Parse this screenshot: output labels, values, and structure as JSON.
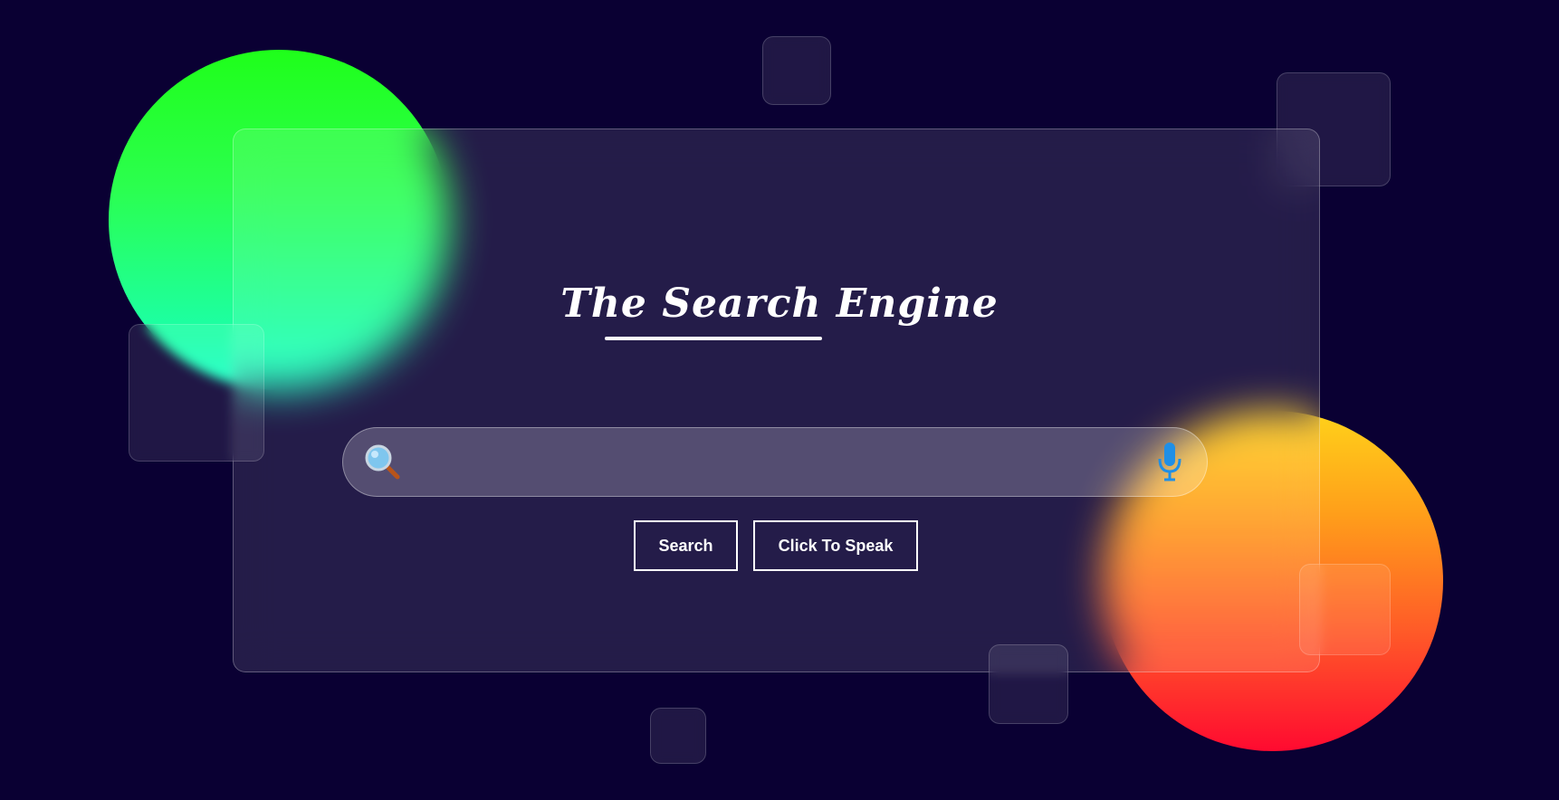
{
  "app": {
    "title": "The Search Engine"
  },
  "search": {
    "value": "",
    "placeholder": "",
    "search_icon": "magnifying-glass-icon",
    "mic_icon": "microphone-icon"
  },
  "buttons": {
    "search_label": "Search",
    "speak_label": "Click To Speak"
  },
  "theme": {
    "background": "#0a0033",
    "accent_green": "#1fff1a",
    "accent_teal": "#16ffc8",
    "accent_orange": "#ff9f1a",
    "accent_red": "#ff0a30",
    "text": "#ffffff"
  }
}
